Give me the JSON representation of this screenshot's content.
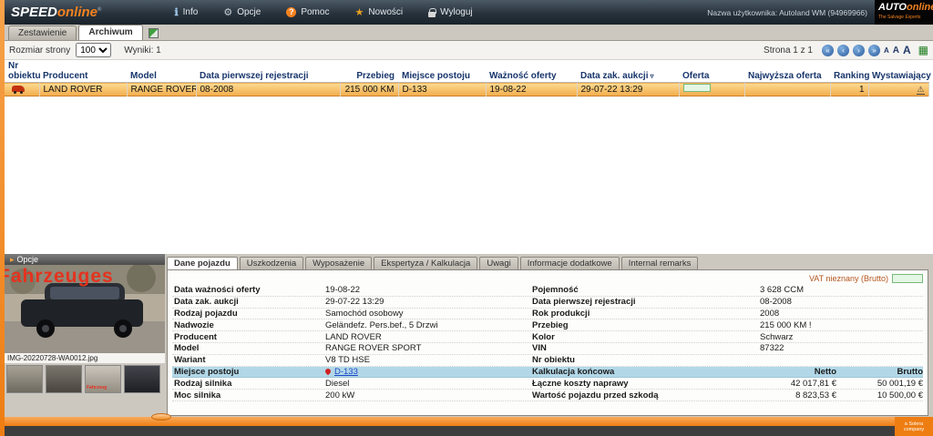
{
  "topbar": {
    "logo": {
      "speed": "SPEED",
      "online": "online",
      "sup": "®"
    },
    "menu": [
      {
        "label": "Info"
      },
      {
        "label": "Opcje"
      },
      {
        "label": "Pomoc"
      },
      {
        "label": "Nowości"
      },
      {
        "label": "Wyloguj"
      }
    ],
    "username": "Nazwa użytkownika: Autoland WM (94969966)",
    "brand": {
      "auto": "AUTO",
      "online": "online",
      "tagline": "The Salvage Experts"
    }
  },
  "tabs": {
    "zestawienie": "Zestawienie",
    "archiwum": "Archiwum"
  },
  "toolbar": {
    "page_size_label": "Rozmiar strony",
    "page_size": "100",
    "results": "Wyniki: 1",
    "page_info": "Strona 1 z 1"
  },
  "table": {
    "columns": [
      "Nr obiektu",
      "Producent",
      "Model",
      "Data pierwszej rejestracji",
      "Przebieg",
      "Miejsce postoju",
      "Ważność oferty",
      "Data zak. aukcji",
      "Oferta",
      "Najwyższa oferta",
      "Ranking",
      "Wystawiający"
    ],
    "row": {
      "producent": "LAND ROVER",
      "model": "RANGE ROVER SPOR...",
      "data_rejestracji": "08-2008",
      "przebieg": "215 000 KM",
      "miejsce": "D-133",
      "waznosc": "19-08-22",
      "data_zak": "29-07-22 13:29",
      "ranking": "1"
    }
  },
  "photo_panel": {
    "opcje": "Opcje",
    "watermark": "Fahrzeuges",
    "filename": "IMG-20220728-WA0012.jpg",
    "thumb_watermark": "Fahrzeug"
  },
  "detail": {
    "tabs": [
      "Dane pojazdu",
      "Uszkodzenia",
      "Wyposażenie",
      "Ekspertyza / Kalkulacja",
      "Uwagi",
      "Informacje dodatkowe",
      "Internal remarks"
    ],
    "vat_label": "VAT nieznany (Brutto)",
    "rows": [
      {
        "ll": "Data ważności oferty",
        "lv": "19-08-22",
        "rl": "Pojemność",
        "rv": "3 628 CCM"
      },
      {
        "ll": "Data zak. aukcji",
        "lv": "29-07-22 13:29",
        "rl": "Data pierwszej rejestracji",
        "rv": "08-2008"
      },
      {
        "ll": "Rodzaj pojazdu",
        "lv": "Samochód osobowy",
        "rl": "Rok produkcji",
        "rv": "2008"
      },
      {
        "ll": "Nadwozie",
        "lv": "Geländefz. Pers.bef., 5 Drzwi",
        "rl": "Przebieg",
        "rv": "215 000 KM !"
      },
      {
        "ll": "Producent",
        "lv": "LAND ROVER",
        "rl": "Kolor",
        "rv": "Schwarz"
      },
      {
        "ll": "Model",
        "lv": "RANGE ROVER SPORT",
        "rl": "VIN",
        "rv": "87322"
      },
      {
        "ll": "Wariant",
        "lv": "V8 TD HSE",
        "rl": "Nr obiektu",
        "rv": ""
      },
      {
        "ll": "Miejsce postoju",
        "lv": "D-133",
        "rl": "Kalkulacja końcowa",
        "rn": "Netto",
        "rb": "Brutto"
      },
      {
        "ll": "Rodzaj silnika",
        "lv": "Diesel",
        "rl": "Łączne koszty naprawy",
        "rn": "42 017,81 €",
        "rb": "50 001,19 €"
      },
      {
        "ll": "Moc silnika",
        "lv": "200 kW",
        "rl": "Wartość pojazdu przed szkodą",
        "rn": "8 823,53 €",
        "rb": "10 500,00 €"
      }
    ]
  },
  "footer": {
    "brand": "a Solera company"
  }
}
